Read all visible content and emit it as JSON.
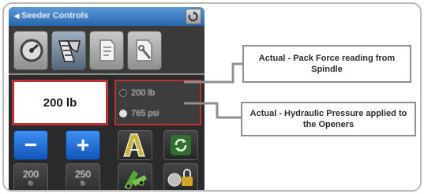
{
  "header": {
    "title": "Seeder Controls",
    "back_glyph": "◄",
    "close_icon": "close-icon"
  },
  "tabs": [
    {
      "name": "gauge-tab",
      "icon": "gauge-icon"
    },
    {
      "name": "opener-tab",
      "icon": "opener-icon",
      "active": true
    },
    {
      "name": "page-tab",
      "icon": "page-icon"
    },
    {
      "name": "tools-tab",
      "icon": "document-tools-icon"
    }
  ],
  "setpoint": {
    "value": "200 lb"
  },
  "readings": [
    {
      "text": "200 lb",
      "color": "#3a3a3a"
    },
    {
      "text": "765 psi",
      "color": "#e0e0e0"
    }
  ],
  "controls": {
    "decrease": "−",
    "increase": "+",
    "preset1": {
      "value": "200",
      "unit": "lb"
    },
    "preset2": {
      "value": "250",
      "unit": "lb"
    }
  },
  "callouts": {
    "pack_force": "Actual - Pack Force reading from Spindle",
    "hydraulic": "Actual - Hydraulic Pressure applied to the Openers"
  },
  "colors": {
    "highlight_red": "#c03030",
    "title_blue": "#2766ad",
    "button_blue": "#1a6ad8"
  }
}
